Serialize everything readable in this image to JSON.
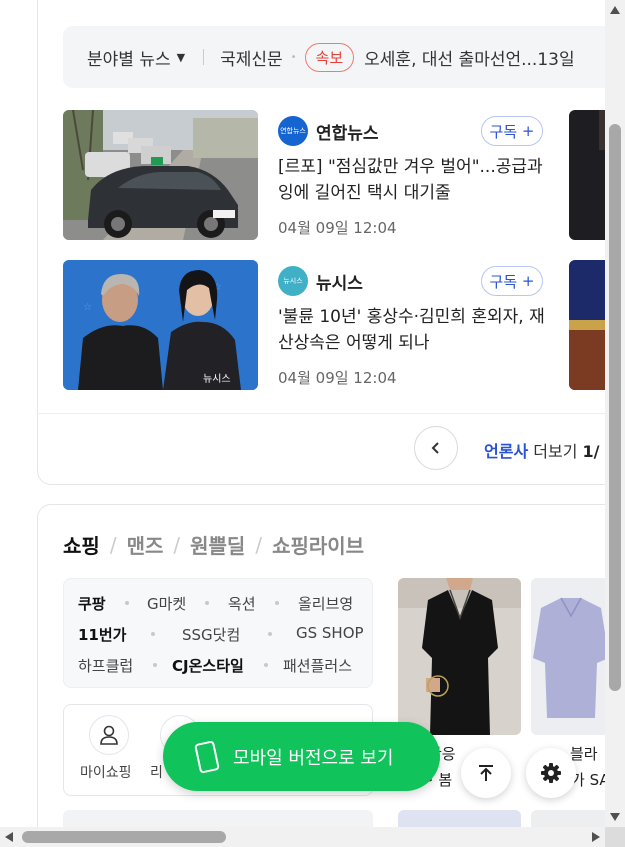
{
  "ticker": {
    "category": "분야별 뉴스",
    "section": "국제신문",
    "breaking_badge": "속보",
    "headline": "오세훈, 대선 출마선언...13일"
  },
  "news": [
    {
      "publisher": "연합뉴스",
      "logo_text": "연합뉴스",
      "subscribe": "구독",
      "headline": "[르포] \"점심값만 겨우 벌어\"...공급과잉에 길어진 택시 대기줄",
      "date": "04월 09일 12:04"
    },
    {
      "publisher": "뉴시스",
      "logo_text": "뉴시스",
      "subscribe": "구독",
      "headline": "'불륜 10년' 홍상수·김민희 혼외자, 재산상속은 어떻게 되나",
      "date": "04월 09일 12:04",
      "photo_watermark": "뉴시스"
    }
  ],
  "pager": {
    "press": "언론사",
    "more": "더보기",
    "page": "1/"
  },
  "shopping": {
    "tabs": [
      "쇼핑",
      "맨즈",
      "원쁠딜",
      "쇼핑라이브"
    ],
    "malls_row1": [
      "쿠팡",
      "G마켓",
      "옥션",
      "올리브영"
    ],
    "malls_row2": [
      "11번가",
      "SSG닷컴",
      "GS SHOP"
    ],
    "malls_row3": [
      "하프클럽",
      "CJ온스타일",
      "패션플러스"
    ],
    "my_shopping": "마이쇼핑",
    "second_shortcut": "리",
    "product1_line1": "반응",
    "product1_line2": "~ 봄",
    "product2_line1": "블라",
    "product2_line2": "가 SA"
  },
  "floating": {
    "mobile_version": "모바일 버전으로 보기"
  },
  "colors": {
    "accent_green": "#10c35a",
    "link_blue": "#2a52d6",
    "breaking_red": "#e8413a"
  }
}
